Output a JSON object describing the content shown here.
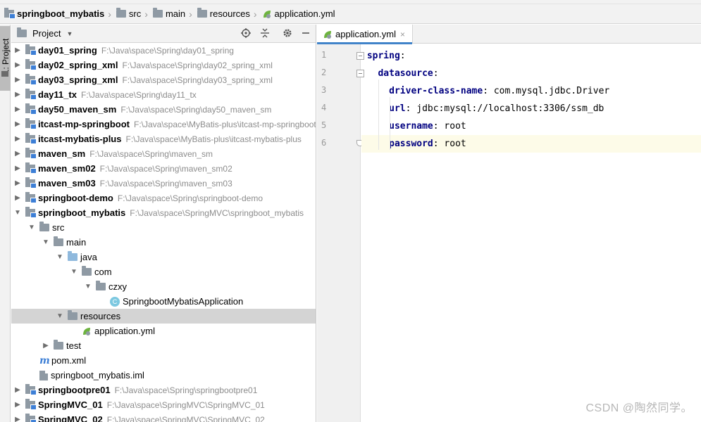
{
  "breadcrumb": [
    {
      "label": "springboot_mybatis",
      "icon": "module-folder-icon",
      "bold": true
    },
    {
      "label": "src",
      "icon": "folder-icon"
    },
    {
      "label": "main",
      "icon": "folder-icon"
    },
    {
      "label": "resources",
      "icon": "resources-folder-icon"
    },
    {
      "label": "application.yml",
      "icon": "yml-file-icon"
    }
  ],
  "toolstrip": {
    "project_tab": "1: Project"
  },
  "panel": {
    "title": "Project"
  },
  "tree": [
    {
      "name": "day01_spring",
      "path": "F:\\Java\\space\\Spring\\day01_spring",
      "arrow": "▶",
      "icon": "module",
      "level": 0,
      "bold": true
    },
    {
      "name": "day02_spring_xml",
      "path": "F:\\Java\\space\\Spring\\day02_spring_xml",
      "arrow": "▶",
      "icon": "module",
      "level": 0,
      "bold": true
    },
    {
      "name": "day03_spring_xml",
      "path": "F:\\Java\\space\\Spring\\day03_spring_xml",
      "arrow": "▶",
      "icon": "module",
      "level": 0,
      "bold": true
    },
    {
      "name": "day11_tx",
      "path": "F:\\Java\\space\\Spring\\day11_tx",
      "arrow": "▶",
      "icon": "module",
      "level": 0,
      "bold": true
    },
    {
      "name": "day50_maven_sm",
      "path": "F:\\Java\\space\\Spring\\day50_maven_sm",
      "arrow": "▶",
      "icon": "module",
      "level": 0,
      "bold": true
    },
    {
      "name": "itcast-mp-springboot",
      "path": "F:\\Java\\space\\MyBatis-plus\\itcast-mp-springboot",
      "arrow": "▶",
      "icon": "module",
      "level": 0,
      "bold": true
    },
    {
      "name": "itcast-mybatis-plus",
      "path": "F:\\Java\\space\\MyBatis-plus\\itcast-mybatis-plus",
      "arrow": "▶",
      "icon": "module",
      "level": 0,
      "bold": true
    },
    {
      "name": "maven_sm",
      "path": "F:\\Java\\space\\Spring\\maven_sm",
      "arrow": "▶",
      "icon": "module",
      "level": 0,
      "bold": true
    },
    {
      "name": "maven_sm02",
      "path": "F:\\Java\\space\\Spring\\maven_sm02",
      "arrow": "▶",
      "icon": "module",
      "level": 0,
      "bold": true
    },
    {
      "name": "maven_sm03",
      "path": "F:\\Java\\space\\Spring\\maven_sm03",
      "arrow": "▶",
      "icon": "module",
      "level": 0,
      "bold": true
    },
    {
      "name": "springboot-demo",
      "path": "F:\\Java\\space\\Spring\\springboot-demo",
      "arrow": "▶",
      "icon": "module",
      "level": 0,
      "bold": true
    },
    {
      "name": "springboot_mybatis",
      "path": "F:\\Java\\space\\SpringMVC\\springboot_mybatis",
      "arrow": "▼",
      "icon": "module",
      "level": 0,
      "bold": true
    },
    {
      "name": "src",
      "path": "",
      "arrow": "▼",
      "icon": "folder",
      "level": 1
    },
    {
      "name": "main",
      "path": "",
      "arrow": "▼",
      "icon": "folder",
      "level": 2
    },
    {
      "name": "java",
      "path": "",
      "arrow": "▼",
      "icon": "folder-blue",
      "level": 3
    },
    {
      "name": "com",
      "path": "",
      "arrow": "▼",
      "icon": "folder",
      "level": 4
    },
    {
      "name": "czxy",
      "path": "",
      "arrow": "▼",
      "icon": "folder",
      "level": 5
    },
    {
      "name": "SpringbootMybatisApplication",
      "path": "",
      "arrow": "",
      "icon": "class",
      "level": 6
    },
    {
      "name": "resources",
      "path": "",
      "arrow": "▼",
      "icon": "resources",
      "level": 3,
      "selected": true
    },
    {
      "name": "application.yml",
      "path": "",
      "arrow": "",
      "icon": "yml",
      "level": 4
    },
    {
      "name": "test",
      "path": "",
      "arrow": "▶",
      "icon": "folder",
      "level": 2
    },
    {
      "name": "pom.xml",
      "path": "",
      "arrow": "",
      "icon": "maven",
      "level": 1
    },
    {
      "name": "springboot_mybatis.iml",
      "path": "",
      "arrow": "",
      "icon": "iml",
      "level": 1
    },
    {
      "name": "springbootpre01",
      "path": "F:\\Java\\space\\Spring\\springbootpre01",
      "arrow": "▶",
      "icon": "module",
      "level": 0,
      "bold": true
    },
    {
      "name": "SpringMVC_01",
      "path": "F:\\Java\\space\\SpringMVC\\SpringMVC_01",
      "arrow": "▶",
      "icon": "module",
      "level": 0,
      "bold": true
    },
    {
      "name": "SpringMVC_02",
      "path": "F:\\Java\\space\\SpringMVC\\SpringMVC_02",
      "arrow": "▶",
      "icon": "module",
      "level": 0,
      "bold": true
    }
  ],
  "editor": {
    "tab_label": "application.yml",
    "tab_close": "×",
    "line_numbers": [
      "1",
      "2",
      "3",
      "4",
      "5",
      "6"
    ],
    "lines": [
      {
        "indent": "",
        "key": "spring",
        "value": ""
      },
      {
        "indent": "  ",
        "key": "datasource",
        "value": ""
      },
      {
        "indent": "    ",
        "key": "driver-class-name",
        "value": "com.mysql.jdbc.Driver"
      },
      {
        "indent": "    ",
        "key": "url",
        "value": "jdbc:mysql://localhost:3306/ssm_db"
      },
      {
        "indent": "    ",
        "key": "username",
        "value": "root"
      },
      {
        "indent": "    ",
        "key": "password",
        "value": "root"
      }
    ],
    "current_line": 6
  },
  "watermark": "CSDN @陶然同学。",
  "colors": {
    "yaml_key": "#000080",
    "selection": "#d4d4d4",
    "current_line": "#fdfbe8"
  }
}
